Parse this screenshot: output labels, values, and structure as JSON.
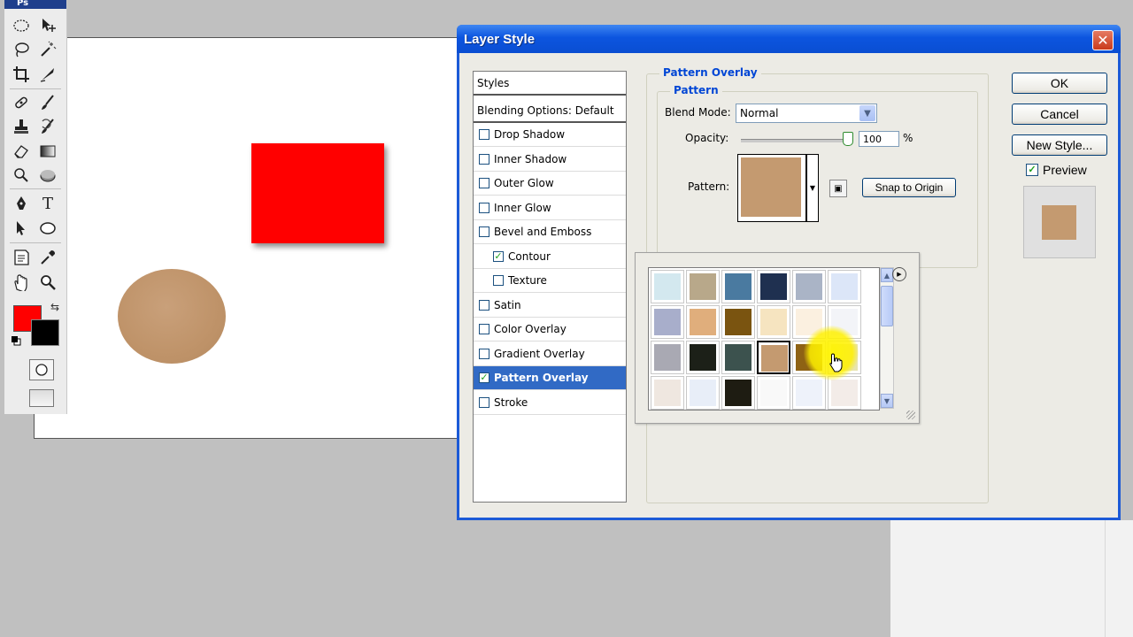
{
  "toolbox": {
    "header_label": "Ps",
    "tools": [
      "marquee-tool",
      "move-tool",
      "lasso-tool",
      "magic-wand-tool",
      "crop-tool",
      "slice-tool",
      "healing-brush-tool",
      "brush-tool",
      "clone-stamp-tool",
      "history-brush-tool",
      "eraser-tool",
      "gradient-tool",
      "dodge-tool",
      "burn-tool",
      "pen-tool",
      "type-tool",
      "path-selection-tool",
      "ellipse-tool",
      "notes-tool",
      "eyedropper-tool",
      "hand-tool",
      "zoom-tool"
    ],
    "type_tool_glyph": "T",
    "foreground_color": "#ff0000",
    "background_color": "#000000"
  },
  "dialog": {
    "title": "Layer Style",
    "close_glyph": "✕"
  },
  "styles_list": {
    "header": "Styles",
    "blending": "Blending Options: Default",
    "items": [
      {
        "label": "Drop Shadow",
        "checked": false,
        "indent": false
      },
      {
        "label": "Inner Shadow",
        "checked": false,
        "indent": false
      },
      {
        "label": "Outer Glow",
        "checked": false,
        "indent": false
      },
      {
        "label": "Inner Glow",
        "checked": false,
        "indent": false
      },
      {
        "label": "Bevel and Emboss",
        "checked": false,
        "indent": false
      },
      {
        "label": "Contour",
        "checked": true,
        "indent": true
      },
      {
        "label": "Texture",
        "checked": false,
        "indent": true
      },
      {
        "label": "Satin",
        "checked": false,
        "indent": false
      },
      {
        "label": "Color Overlay",
        "checked": false,
        "indent": false
      },
      {
        "label": "Gradient Overlay",
        "checked": false,
        "indent": false
      },
      {
        "label": "Pattern Overlay",
        "checked": true,
        "indent": false,
        "selected": true
      },
      {
        "label": "Stroke",
        "checked": false,
        "indent": false
      }
    ]
  },
  "pattern_overlay": {
    "section_title": "Pattern Overlay",
    "group_title": "Pattern",
    "blend_mode_label": "Blend Mode:",
    "blend_mode_value": "Normal",
    "opacity_label": "Opacity:",
    "opacity_value": "100",
    "opacity_unit": "%",
    "opacity_level": 1.0,
    "pattern_label": "Pattern:",
    "pattern_color": "#c49a70",
    "snap_button": "Snap to Origin"
  },
  "pattern_picker": {
    "swatches": [
      "#d3e8ef",
      "#b8a88a",
      "#4a7aa0",
      "#1f3050",
      "#aab4c6",
      "#dce6f8",
      "#a8aecb",
      "#e0ae7c",
      "#7a5410",
      "#f6e4c0",
      "#fbf0e0",
      "#f3f4f8",
      "#a9a9b3",
      "#1c2018",
      "#3c524e",
      "#c49a70",
      "#8e6214",
      "#e8e4b0",
      "#efe7e0",
      "#e8eef8",
      "#1e1c12",
      "#f9f9f9",
      "#eef2fa",
      "#f3ece8"
    ],
    "selected_index": 15
  },
  "buttons": {
    "ok": "OK",
    "cancel": "Cancel",
    "new_style": "New Style...",
    "preview_label": "Preview",
    "preview_checked": true
  },
  "canvas": {
    "rect_color": "#ff0000",
    "ellipse_color": "#c49a70"
  }
}
